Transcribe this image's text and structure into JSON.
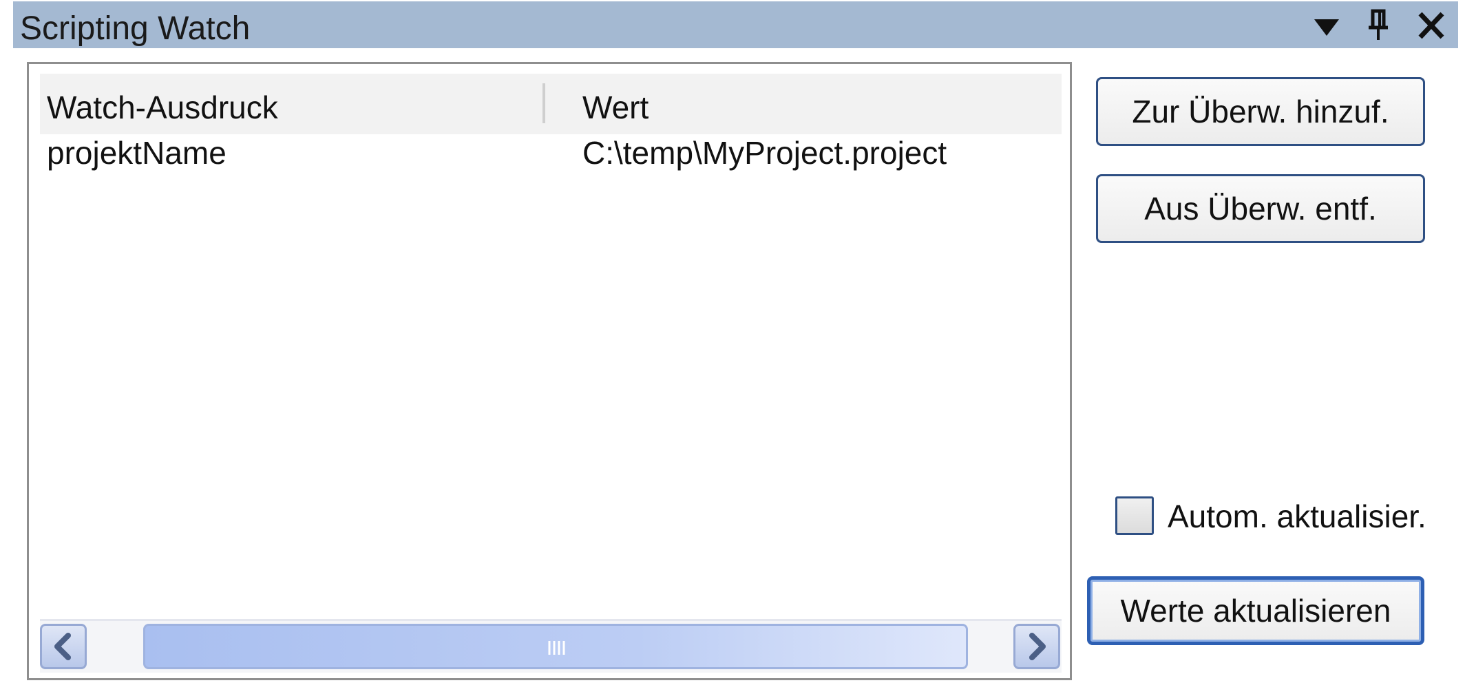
{
  "window": {
    "title": "Scripting Watch",
    "icons": {
      "dropdown": "triangle-down-icon",
      "pin": "pin-icon",
      "close": "close-icon"
    }
  },
  "watch_list": {
    "columns": [
      "Watch-Ausdruck",
      "Wert"
    ],
    "rows": [
      [
        "projektName",
        "C:\\temp\\MyProject.project"
      ]
    ]
  },
  "buttons": {
    "add_label": "Zur Überw. hinzuf.",
    "remove_label": "Aus Überw. entf.",
    "refresh_label": "Werte aktualisieren"
  },
  "auto_update": {
    "label": "Autom. aktualisier.",
    "checked": false
  },
  "colors": {
    "titlebar": "#a4b9d2",
    "button_border": "#2e4f83",
    "scrollbar_thumb": "#bccdf4"
  }
}
